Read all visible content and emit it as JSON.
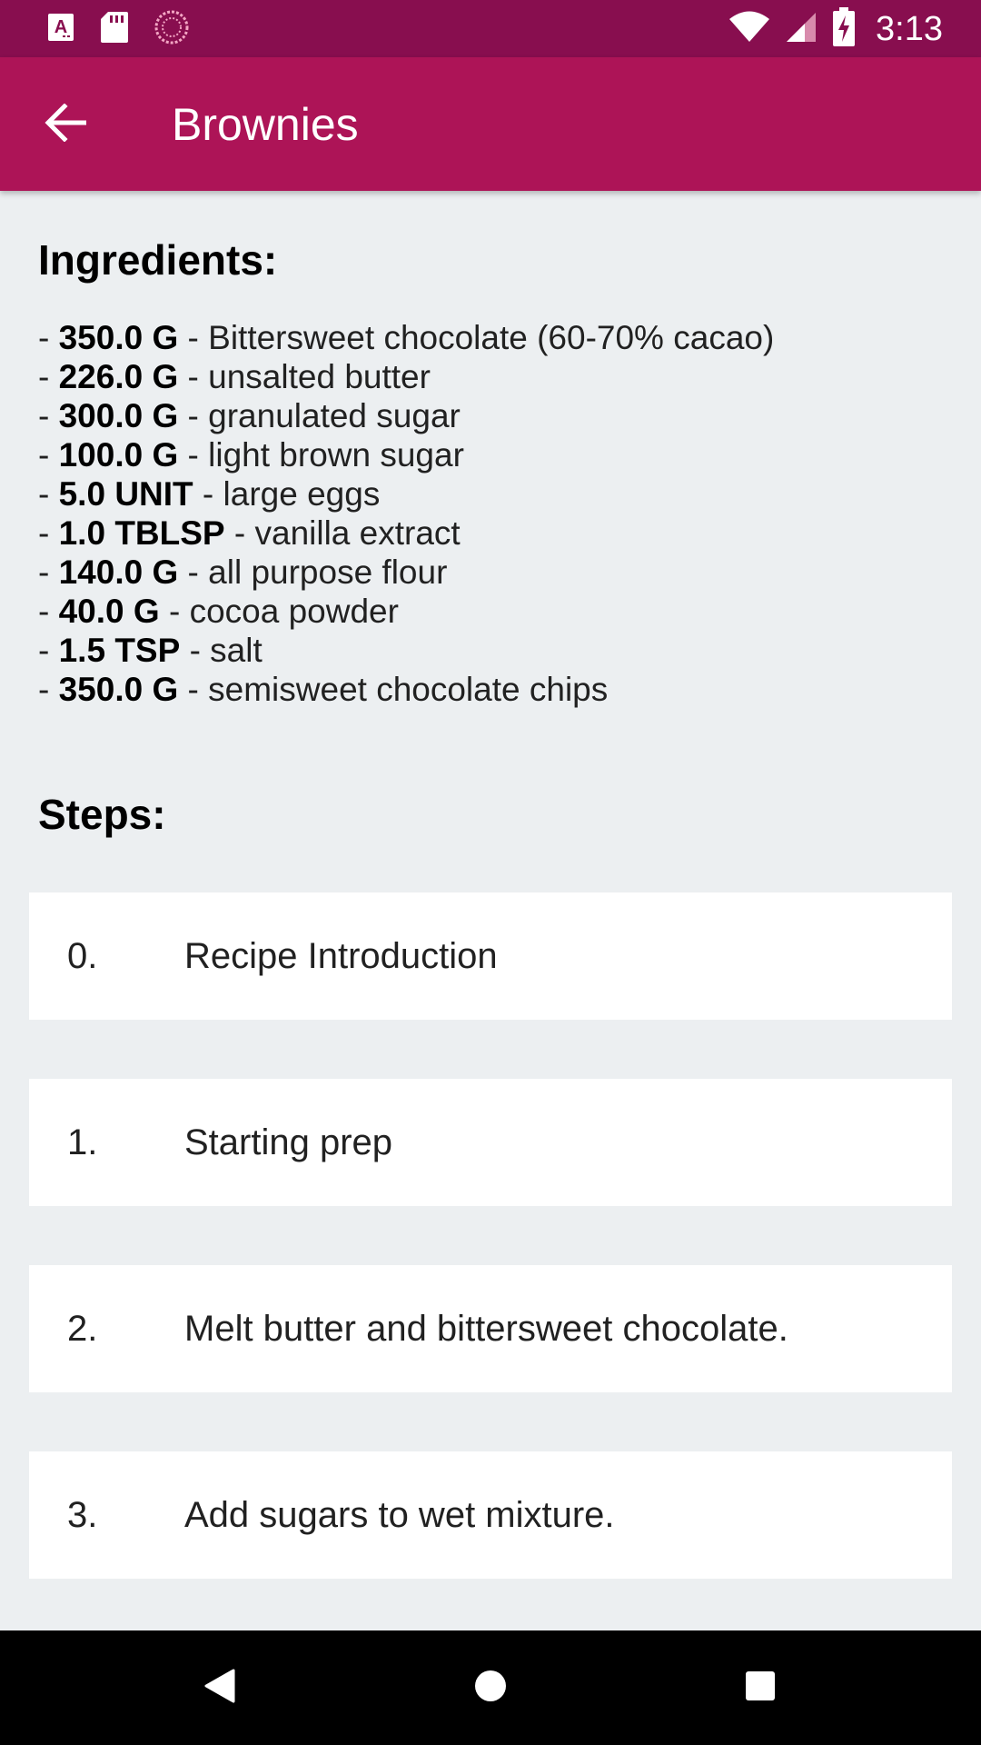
{
  "status_bar": {
    "time": "3:13",
    "icons": [
      "a-notification-icon",
      "sd-card-icon",
      "sync-icon",
      "wifi-icon",
      "cell-signal-icon",
      "battery-charging-icon"
    ]
  },
  "app_bar": {
    "title": "Brownies",
    "back_icon": "arrow-back-icon"
  },
  "ingredients": {
    "heading": "Ingredients:",
    "items": [
      {
        "prefix": "- ",
        "qty": "350.0 G",
        "name": " - Bittersweet chocolate (60-70% cacao)"
      },
      {
        "prefix": "- ",
        "qty": "226.0 G",
        "name": " - unsalted butter"
      },
      {
        "prefix": "- ",
        "qty": "300.0 G",
        "name": " - granulated sugar"
      },
      {
        "prefix": "- ",
        "qty": "100.0 G",
        "name": " - light brown sugar"
      },
      {
        "prefix": "- ",
        "qty": "5.0 UNIT",
        "name": " - large eggs"
      },
      {
        "prefix": "- ",
        "qty": "1.0 TBLSP",
        "name": " - vanilla extract"
      },
      {
        "prefix": "- ",
        "qty": "140.0 G",
        "name": " - all purpose flour"
      },
      {
        "prefix": "- ",
        "qty": "40.0 G",
        "name": " - cocoa powder"
      },
      {
        "prefix": "- ",
        "qty": "1.5 TSP",
        "name": " - salt"
      },
      {
        "prefix": "- ",
        "qty": "350.0 G",
        "name": " - semisweet chocolate chips"
      }
    ]
  },
  "steps": {
    "heading": "Steps:",
    "items": [
      {
        "number": "0.",
        "text": "Recipe Introduction"
      },
      {
        "number": "1.",
        "text": "Starting prep"
      },
      {
        "number": "2.",
        "text": "Melt butter and bittersweet chocolate."
      },
      {
        "number": "3.",
        "text": "Add sugars to wet mixture."
      }
    ]
  },
  "nav_bar": {
    "icons": [
      "back-triangle-icon",
      "home-circle-icon",
      "recents-square-icon"
    ]
  },
  "colors": {
    "status_bar": "#880e4f",
    "app_bar": "#ad1457",
    "background": "#eceff1",
    "card": "#ffffff"
  }
}
